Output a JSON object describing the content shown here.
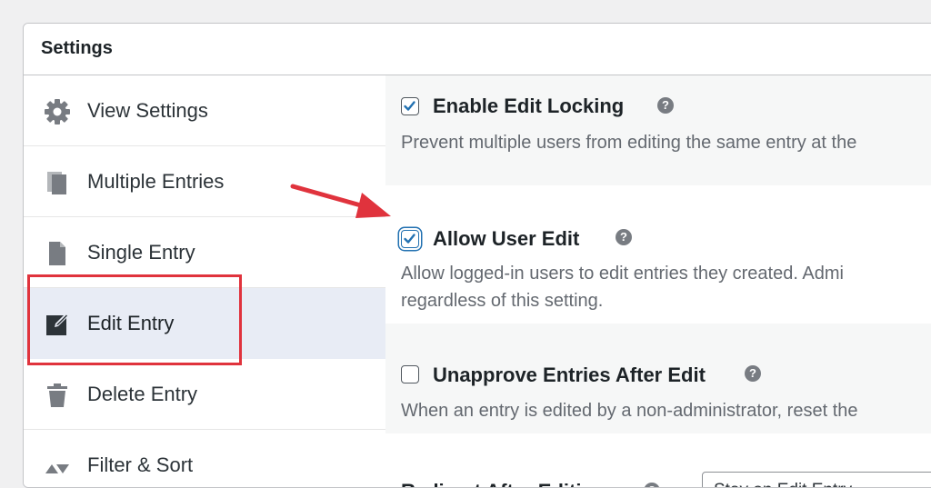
{
  "panel": {
    "title": "Settings"
  },
  "sidebar": {
    "items": [
      {
        "label": "View Settings",
        "icon": "gear-icon"
      },
      {
        "label": "Multiple Entries",
        "icon": "copy-icon"
      },
      {
        "label": "Single Entry",
        "icon": "document-icon"
      },
      {
        "label": "Edit Entry",
        "icon": "edit-icon",
        "active": true
      },
      {
        "label": "Delete Entry",
        "icon": "trash-icon"
      },
      {
        "label": "Filter & Sort",
        "icon": "sort-icon"
      }
    ]
  },
  "settings": [
    {
      "label": "Enable Edit Locking",
      "checked": true,
      "description": [
        "Prevent multiple users from editing the same entry at the"
      ]
    },
    {
      "label": "Allow User Edit",
      "checked": true,
      "description": [
        "Allow logged-in users to edit entries they created. Admi",
        "regardless of this setting."
      ]
    },
    {
      "label": "Unapprove Entries After Edit",
      "checked": false,
      "description": [
        "When an entry is edited by a non-administrator, reset the"
      ]
    }
  ],
  "redirect": {
    "label": "Redirect After Editing",
    "selected": "Stay on Edit Entry"
  },
  "colors": {
    "highlight_box": "#e0333d",
    "arrow": "#e0333d",
    "checkbox_accent": "#2271b1",
    "active_sidebar_bg": "#e8ecf5"
  }
}
